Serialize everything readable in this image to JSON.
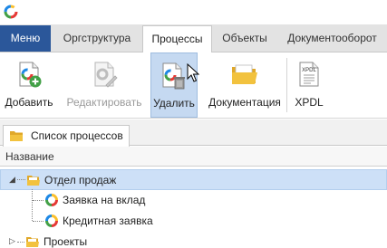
{
  "window": {
    "logo_icon": "app-logo-icon"
  },
  "tabs": {
    "menu_label": "Меню",
    "items": [
      {
        "label": "Оргструктура"
      },
      {
        "label": "Процессы",
        "active": true
      },
      {
        "label": "Объекты"
      },
      {
        "label": "Документооборот"
      }
    ]
  },
  "ribbon": {
    "add_label": "Добавить",
    "edit_label": "Редактировать",
    "delete_label": "Удалить",
    "docs_label": "Документация",
    "xpdl_label": "XPDL",
    "xpdl_icon_text": "XPDL"
  },
  "panel": {
    "tab_label": "Список процессов",
    "column_header": "Название"
  },
  "tree": [
    {
      "label": "Отдел продаж",
      "expanded": true,
      "selected": true,
      "children": [
        {
          "label": "Заявка на вклад"
        },
        {
          "label": "Кредитная заявка"
        }
      ]
    },
    {
      "label": "Проекты",
      "expanded": false
    }
  ],
  "colors": {
    "menu_bg": "#2b579a",
    "selected_row": "#cde0f7",
    "hover_button": "#c5d9f1",
    "folder": "#f2c23e"
  }
}
